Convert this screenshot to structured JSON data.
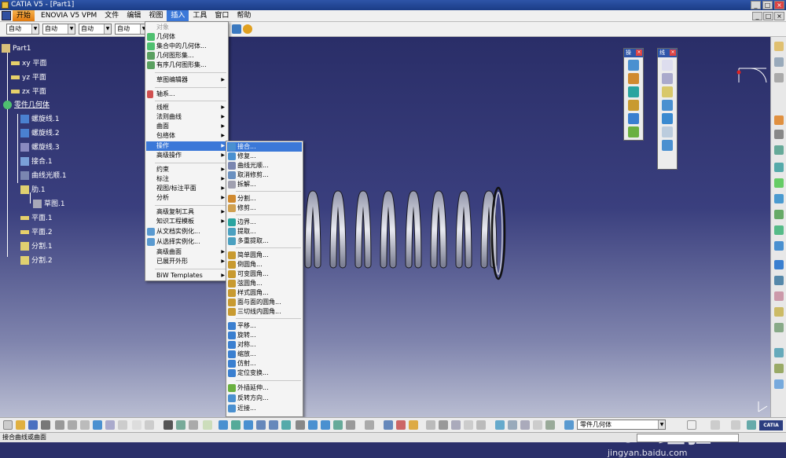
{
  "window": {
    "title": "CATIA V5 - [Part1]",
    "buttons": [
      "_",
      "□",
      "×"
    ]
  },
  "menubar": {
    "items": [
      "开始",
      "ENOVIA V5 VPM",
      "文件",
      "编辑",
      "视图",
      "插入",
      "工具",
      "窗口",
      "帮助"
    ],
    "active": "插入"
  },
  "toolbar": {
    "combos": [
      "自动",
      "自动",
      "自动",
      "自动"
    ]
  },
  "tree": {
    "root": "Part1",
    "planes": [
      "xy 平面",
      "yz 平面",
      "zx 平面"
    ],
    "body": "零件几何体",
    "body_children": [
      "螺旋线.1",
      "螺旋线.2",
      "螺旋线.3",
      "接合.1",
      "曲线光顺.1"
    ],
    "rib": "肋.1",
    "rib_child": "草图.1",
    "tail": [
      "平面.1",
      "平面.2",
      "分割.1",
      "分割.2"
    ]
  },
  "insert_menu": {
    "items": [
      {
        "label": "对象",
        "disabled": true
      },
      {
        "label": "几何体"
      },
      {
        "label": "集合中的几何体..."
      },
      {
        "label": "几何图形集..."
      },
      {
        "label": "有序几何图形集..."
      },
      {
        "label": "草图编辑器",
        "sub": true
      },
      {
        "label": "轴系..."
      },
      {
        "label": "线框",
        "sub": true
      },
      {
        "label": "法则曲线",
        "sub": true
      },
      {
        "label": "曲面",
        "sub": true
      },
      {
        "label": "包络体",
        "sub": true
      },
      {
        "label": "操作",
        "sub": true,
        "highlight": true
      },
      {
        "label": "高级操作",
        "sub": true
      },
      {
        "label": "约束",
        "sub": true
      },
      {
        "label": "标注",
        "sub": true
      },
      {
        "label": "视图/标注平面",
        "sub": true
      },
      {
        "label": "分析",
        "sub": true
      },
      {
        "label": "高级复制工具",
        "sub": true
      },
      {
        "label": "知识工程模板",
        "sub": true
      },
      {
        "label": "从文档实例化..."
      },
      {
        "label": "从选择实例化..."
      },
      {
        "label": "高级曲面",
        "sub": true
      },
      {
        "label": "已展开外形",
        "sub": true
      },
      {
        "label": "BiW Templates",
        "sub": true
      }
    ]
  },
  "operations_menu": {
    "items": [
      "接合...",
      "修复...",
      "曲线光顺...",
      "取消修剪...",
      "拆解...",
      "分割...",
      "修剪...",
      "边界...",
      "提取...",
      "多重提取...",
      "简单圆角...",
      "倒圆角...",
      "可变圆角...",
      "弦圆角...",
      "样式圆角...",
      "面与面的圆角...",
      "三切线内圆角...",
      "平移...",
      "旋转...",
      "对称...",
      "缩放...",
      "仿射...",
      "定位变换...",
      "外插延伸...",
      "反转方向...",
      "近接..."
    ],
    "highlight": "接合..."
  },
  "float_toolbars": {
    "left_title": "操",
    "right_title": "线"
  },
  "bottom": {
    "body_combo": "零件几何体"
  },
  "status": {
    "text": "接合曲线或曲面"
  },
  "watermark": {
    "logo": "Bai 经验",
    "url": "jingyan.baidu.com"
  },
  "corner_logo": "CATIA"
}
